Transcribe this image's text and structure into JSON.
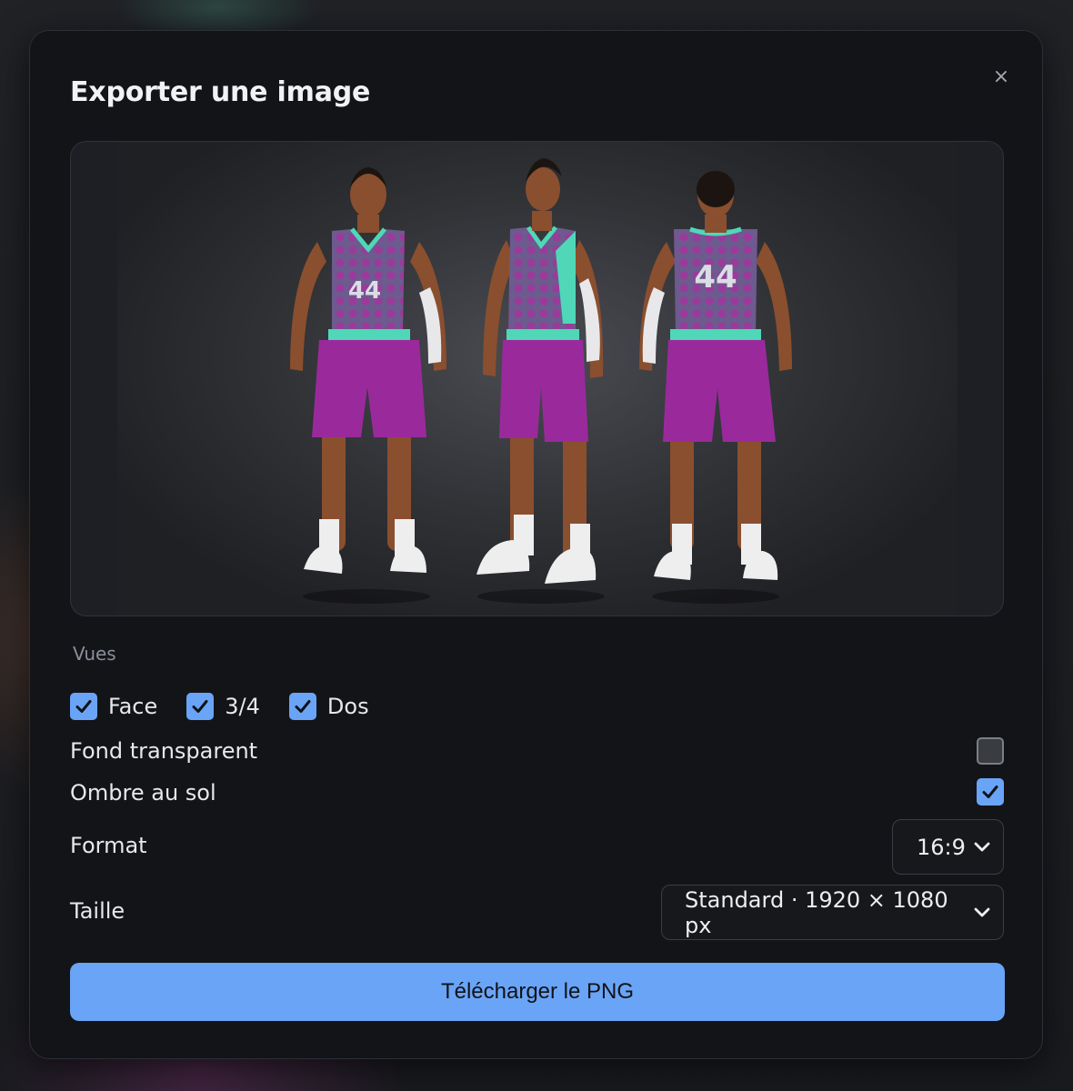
{
  "modal": {
    "title": "Exporter une image",
    "close_label": "×"
  },
  "preview": {
    "jersey_number": "44",
    "colors": {
      "jersey": "#6d5a8e",
      "jersey_dots": "#9b3a9a",
      "trim": "#4fd7b8",
      "shorts": "#9a2a9c",
      "skin": "#8a4f2e",
      "sleeve": "#e8e8ea",
      "shoe": "#eeeeee"
    }
  },
  "views": {
    "label": "Vues",
    "options": [
      {
        "label": "Face",
        "checked": true
      },
      {
        "label": "3/4",
        "checked": true
      },
      {
        "label": "Dos",
        "checked": true
      }
    ]
  },
  "options": {
    "transparent_label": "Fond transparent",
    "transparent_checked": false,
    "shadow_label": "Ombre au sol",
    "shadow_checked": true
  },
  "format": {
    "label": "Format",
    "value": "16:9"
  },
  "size": {
    "label": "Taille",
    "value": "Standard · 1920 × 1080 px"
  },
  "download": {
    "label": "Télécharger le PNG"
  },
  "accent": "#6aa4f6"
}
